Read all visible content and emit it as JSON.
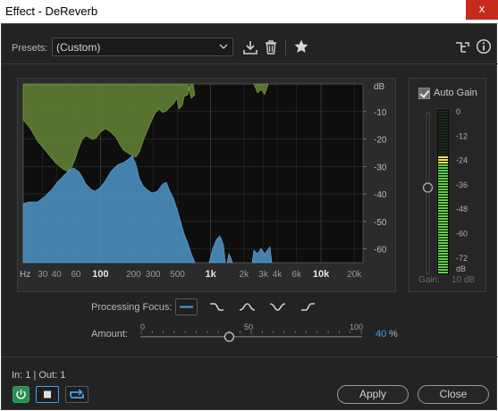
{
  "window": {
    "title": "Effect - DeReverb",
    "close_glyph": "x"
  },
  "presets": {
    "label": "Presets:",
    "value": "(Custom)"
  },
  "graph": {
    "db_label": "dB",
    "db_ticks": [
      "-10",
      "-20",
      "-30",
      "-40",
      "-50",
      "-60"
    ],
    "hz_label": "Hz",
    "freq_ticks": [
      "30",
      "40",
      "60",
      "100",
      "200",
      "300",
      "500",
      "1k",
      "2k",
      "3k",
      "4k",
      "6k",
      "10k",
      "20k"
    ],
    "colors": {
      "input": "#5f7e33",
      "output": "#4a8fbf",
      "grid": "#3a3a3a",
      "bg": "#0e0e0e"
    }
  },
  "auto_gain": {
    "label": "Auto Gain",
    "checked": true,
    "meter_ticks": [
      "0",
      "-12",
      "-24",
      "-36",
      "-48",
      "-60",
      "-72"
    ],
    "meter_unit": "dB",
    "gain_label": "Gain:",
    "gain_value": "10 dB",
    "meter_level_db": -24
  },
  "processing_focus": {
    "label": "Processing Focus:",
    "active_index": 0
  },
  "amount": {
    "label": "Amount:",
    "min": "0",
    "mid": "50",
    "max": "100",
    "value": "40",
    "unit": "%",
    "fraction": 0.4
  },
  "io": {
    "text": "In: 1 | Out: 1"
  },
  "buttons": {
    "apply": "Apply",
    "close": "Close"
  },
  "icons": [
    "download-icon",
    "trash-icon",
    "star-icon",
    "routing-icon",
    "info-icon",
    "power-icon",
    "stop-icon",
    "loop-icon",
    "chevron-down-icon"
  ]
}
